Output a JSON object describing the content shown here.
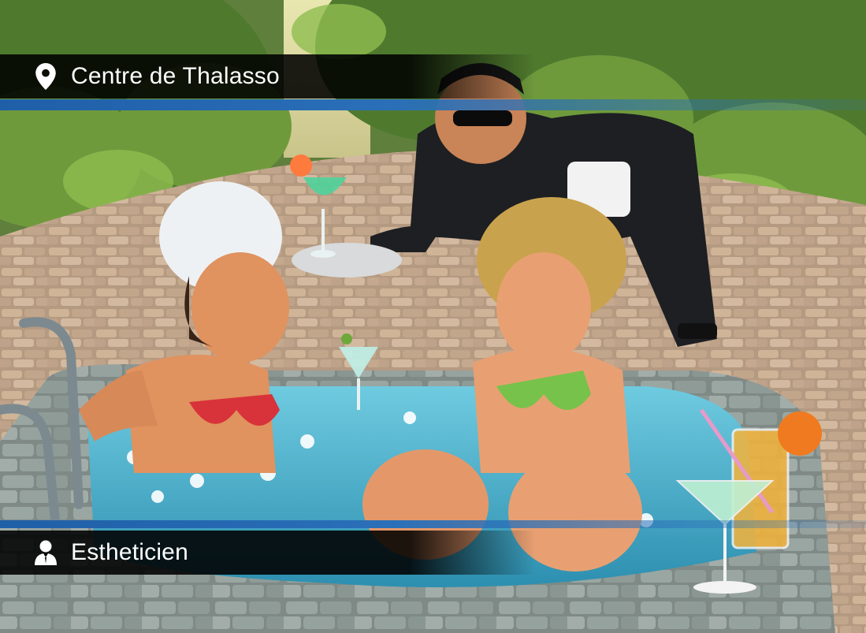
{
  "location": {
    "icon": "location-pin-icon",
    "label": "Centre de Thalasso"
  },
  "profession": {
    "icon": "person-suit-icon",
    "label": "Estheticien"
  },
  "colors": {
    "bar_background": "#000000",
    "accent_stripe": "#2a6fb8",
    "text": "#ffffff"
  },
  "scene": {
    "type": "illustration",
    "subjects": [
      "hot-tub",
      "two-women",
      "waiter",
      "cocktails"
    ]
  }
}
